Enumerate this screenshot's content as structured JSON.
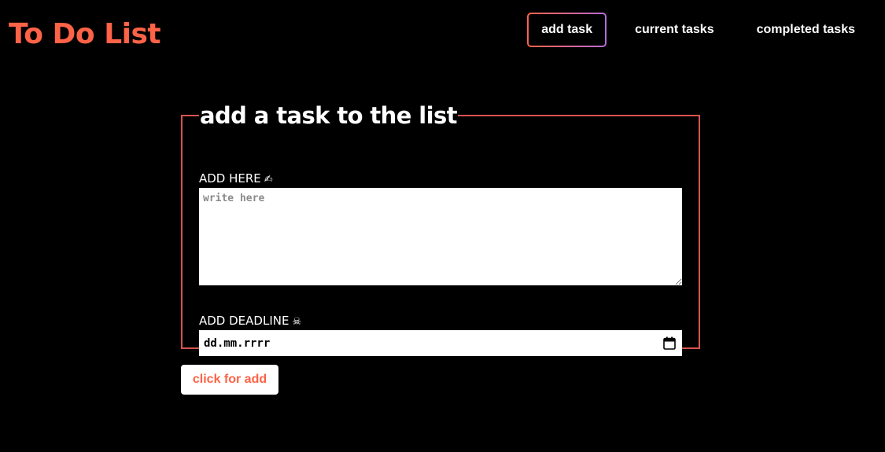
{
  "app": {
    "title": "To Do List"
  },
  "nav": {
    "items": [
      {
        "label": "add task",
        "active": true
      },
      {
        "label": "current tasks",
        "active": false
      },
      {
        "label": "completed tasks",
        "active": false
      }
    ]
  },
  "form": {
    "legend": "add a task to the list",
    "task_label": "ADD HERE",
    "task_emoji": "✍",
    "task_placeholder": "write here",
    "task_value": "",
    "deadline_label": "ADD DEADLINE",
    "deadline_emoji": "☠",
    "deadline_value": "dd.mm.rrrr",
    "submit_label": "click for add"
  },
  "colors": {
    "accent": "#ff6347",
    "border": "#d9534f",
    "background": "#000000",
    "nav_gradient_end": "#b86ad8"
  },
  "icons": {
    "deadline_picker": "calendar-icon"
  }
}
